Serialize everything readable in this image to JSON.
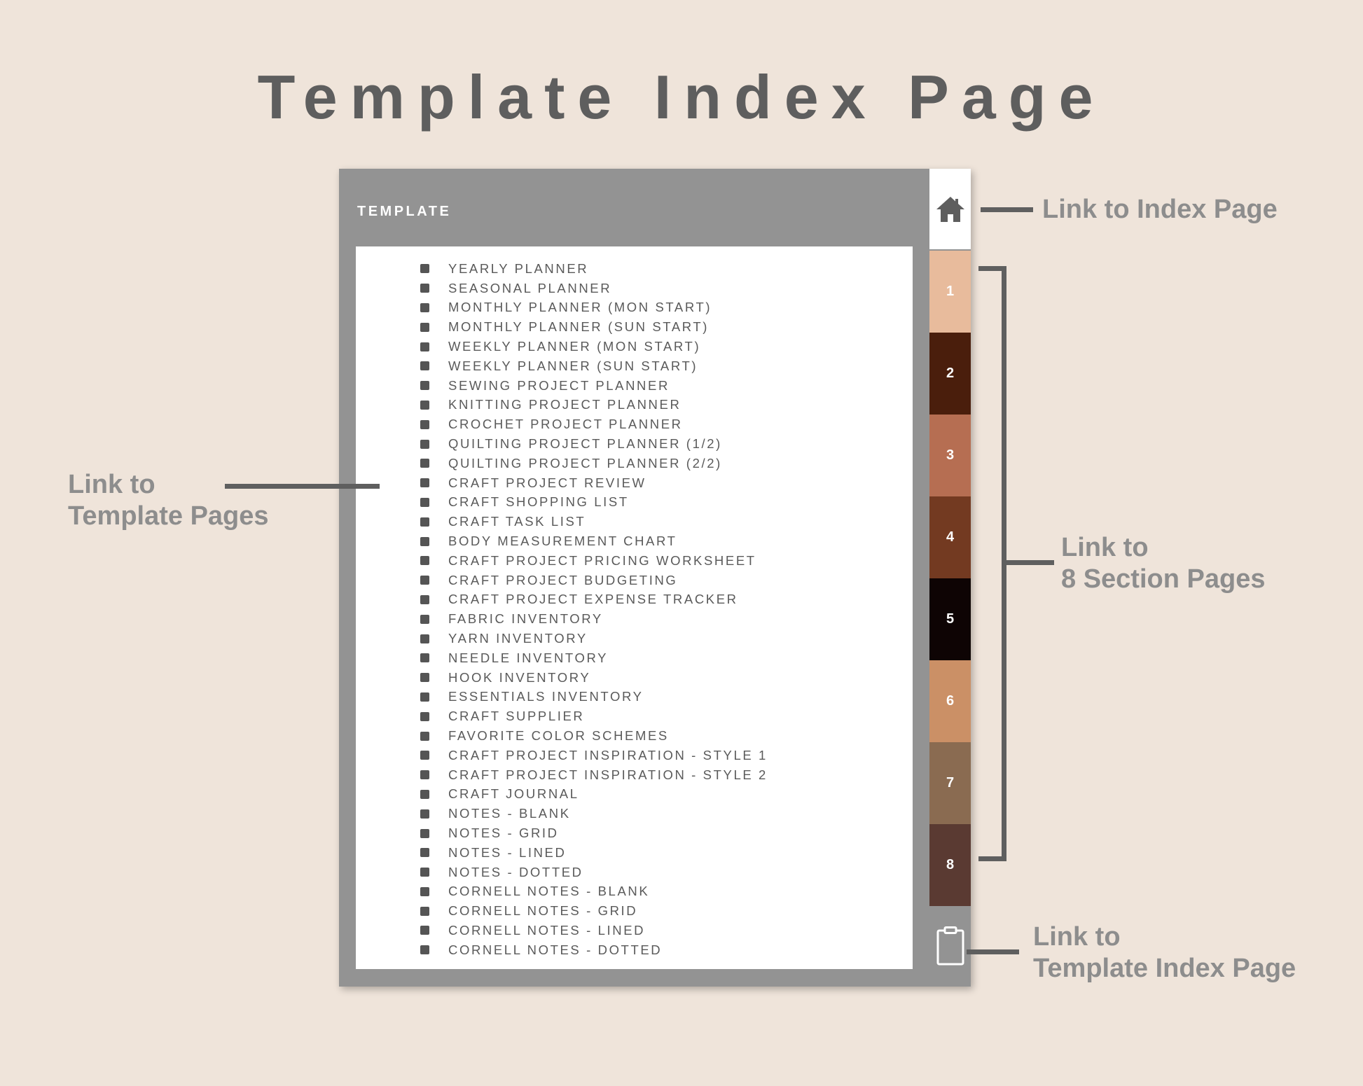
{
  "title": "Template Index Page",
  "device": {
    "header": "TEMPLATE",
    "items": [
      "YEARLY PLANNER",
      "SEASONAL PLANNER",
      "MONTHLY PLANNER (MON START)",
      "MONTHLY PLANNER (SUN START)",
      "WEEKLY PLANNER (MON START)",
      "WEEKLY PLANNER (SUN START)",
      "SEWING PROJECT PLANNER",
      "KNITTING PROJECT PLANNER",
      "CROCHET PROJECT PLANNER",
      "QUILTING PROJECT PLANNER (1/2)",
      "QUILTING PROJECT PLANNER (2/2)",
      "CRAFT PROJECT REVIEW",
      "CRAFT SHOPPING LIST",
      "CRAFT TASK LIST",
      "BODY MEASUREMENT CHART",
      "CRAFT PROJECT PRICING WORKSHEET",
      "CRAFT PROJECT BUDGETING",
      "CRAFT PROJECT EXPENSE TRACKER",
      "FABRIC INVENTORY",
      "YARN INVENTORY",
      "NEEDLE INVENTORY",
      "HOOK INVENTORY",
      "ESSENTIALS INVENTORY",
      "CRAFT SUPPLIER",
      "FAVORITE COLOR SCHEMES",
      "CRAFT PROJECT INSPIRATION - STYLE 1",
      "CRAFT PROJECT INSPIRATION - STYLE 2",
      "CRAFT JOURNAL",
      "NOTES - BLANK",
      "NOTES - GRID",
      "NOTES - LINED",
      "NOTES - DOTTED",
      "CORNELL NOTES - BLANK",
      "CORNELL NOTES - GRID",
      "CORNELL NOTES - LINED",
      "CORNELL NOTES - DOTTED"
    ]
  },
  "sidebar": {
    "home_icon": "home-icon",
    "tabs": [
      {
        "label": "1",
        "color": "#e8bb9c"
      },
      {
        "label": "2",
        "color": "#4a1e0c"
      },
      {
        "label": "3",
        "color": "#b66e52"
      },
      {
        "label": "4",
        "color": "#733a21"
      },
      {
        "label": "5",
        "color": "#0e0404"
      },
      {
        "label": "6",
        "color": "#cb9066"
      },
      {
        "label": "7",
        "color": "#8a6b51"
      },
      {
        "label": "8",
        "color": "#5a3a32"
      }
    ],
    "bottom_icon": "clipboard-icon"
  },
  "annotations": {
    "index_page": "Link to Index Page",
    "template_pages": [
      "Link to",
      "Template Pages"
    ],
    "section_pages": [
      "Link to",
      "8 Section Pages"
    ],
    "template_index_page": [
      "Link to",
      "Template Index Page"
    ]
  },
  "colors": {
    "background": "#efe4da",
    "device": "#939393",
    "text": "#5a5a5a",
    "annotation": "#8d8d8d"
  }
}
